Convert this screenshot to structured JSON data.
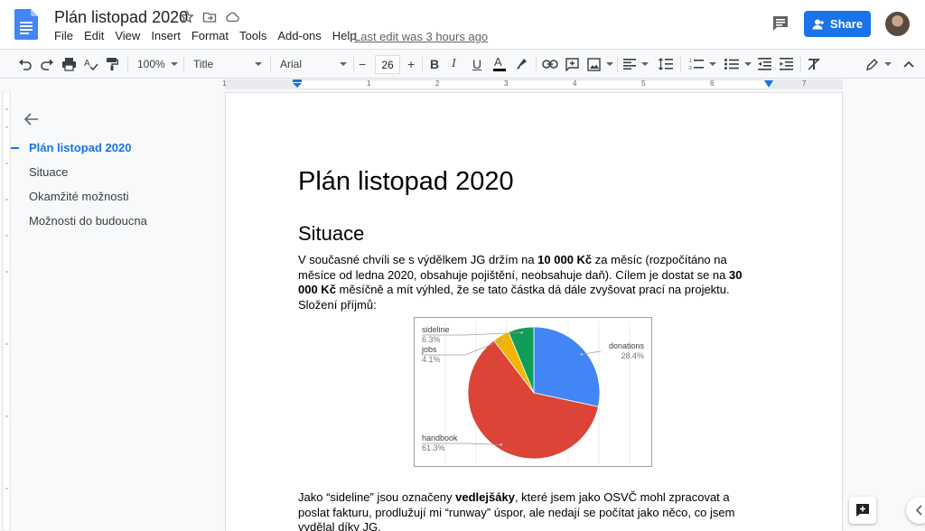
{
  "doc_title": "Plán listopad 2020",
  "menu": [
    "File",
    "Edit",
    "View",
    "Insert",
    "Format",
    "Tools",
    "Add-ons",
    "Help"
  ],
  "last_edit": "Last edit was 3 hours ago",
  "share_label": "Share",
  "toolbar": {
    "zoom": "100%",
    "style": "Title",
    "font": "Arial",
    "font_size": "26",
    "minus": "−",
    "plus": "+"
  },
  "ruler_numbers": [
    "1",
    "1",
    "2",
    "3",
    "4",
    "5",
    "6",
    "7"
  ],
  "outline": {
    "items": [
      "Plán listopad 2020",
      "Situace",
      "Okamžité možnosti",
      "Možnosti do budoucna"
    ]
  },
  "document": {
    "h1": "Plán listopad 2020",
    "h2": "Situace",
    "p1": [
      {
        "text": "V současné chvíli se s výdělkem JG držím na ",
        "bold": false
      },
      {
        "text": "10 000 Kč",
        "bold": true
      },
      {
        "text": " za měsíc (rozpočítáno na měsíce od ledna 2020, obsahuje pojištění, neobsahuje daň). Cílem je dostat se na ",
        "bold": false
      },
      {
        "text": "30 000 Kč",
        "bold": true
      },
      {
        "text": " měsíčně a mít výhled, že se tato částka dá dále zvyšovat prací na projektu. Složení příjmů:",
        "bold": false
      }
    ],
    "p2": [
      {
        "text": "Jako “sideline” jsou označeny ",
        "bold": false
      },
      {
        "text": "vedlejšáky",
        "bold": true
      },
      {
        "text": ", které jsem jako OSVČ mohl zpracovat a poslat fakturu, prodlužují mi “runway” úspor, ale nedají se počítat jako něco, co jsem vydělal díky JG.",
        "bold": false
      }
    ]
  },
  "chart_data": {
    "type": "pie",
    "slices": [
      {
        "label": "donations",
        "value": 28.4,
        "display": "28.4%",
        "color": "#4285f4"
      },
      {
        "label": "handbook",
        "value": 61.3,
        "display": "61.3%",
        "color": "#db4437"
      },
      {
        "label": "jobs",
        "value": 4.1,
        "display": "4.1%",
        "color": "#f4b400"
      },
      {
        "label": "sideline",
        "value": 6.3,
        "display": "6.3%",
        "color": "#0f9d58"
      }
    ],
    "legend": "labels beside slices",
    "grid": true
  },
  "colors": {
    "accent": "#1a73e8",
    "outline_active": "#1a73e8"
  }
}
